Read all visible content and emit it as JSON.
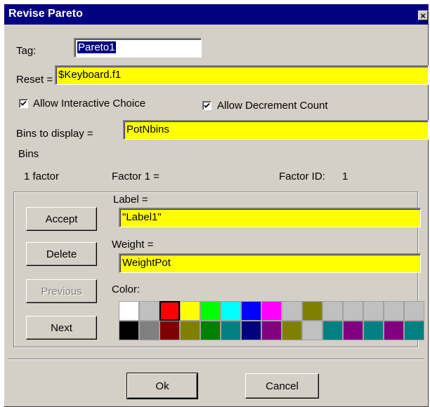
{
  "window": {
    "title": "Revise Pareto",
    "close_glyph": "×"
  },
  "tag": {
    "label": "Tag:",
    "value": "Pareto1"
  },
  "reset": {
    "label": "Reset =",
    "value": "$Keyboard.f1"
  },
  "checkboxes": {
    "allow_interactive": {
      "label": "Allow Interactive Choice",
      "checked": true
    },
    "allow_decrement": {
      "label": "Allow Decrement Count",
      "checked": true
    }
  },
  "bins_to_display": {
    "label": "Bins to display =",
    "value": "PotNbins"
  },
  "bins": {
    "group_label": "Bins",
    "factor_count": "1 factor",
    "factor_label": "Factor 1 =",
    "factor_id_label": "Factor ID:",
    "factor_id_value": "1",
    "label_label": "Label =",
    "label_value": "\"Label1\"",
    "weight_label": "Weight =",
    "weight_value": "WeightPot",
    "color_label": "Color:",
    "buttons": {
      "accept": "Accept",
      "delete": "Delete",
      "previous": "Previous",
      "next": "Next"
    },
    "palette_row1": [
      "#ffffff",
      "#c0c0c0",
      "#ff0000",
      "#ffff00",
      "#00ff00",
      "#00ffff",
      "#0000ff",
      "#ff00ff",
      "#c0c0c0",
      "#808000",
      "#c0c0c0",
      "#c0c0c0",
      "#c0c0c0",
      "#c0c0c0",
      "#c0c0c0"
    ],
    "palette_row2": [
      "#000000",
      "#808080",
      "#800000",
      "#808000",
      "#008000",
      "#008080",
      "#000080",
      "#800080",
      "#808000",
      "#c0c0c0",
      "#008080",
      "#800080",
      "#008080",
      "#800080",
      "#008080"
    ],
    "selected_color": "#ff0000"
  },
  "footer": {
    "ok": "Ok",
    "cancel": "Cancel"
  },
  "colors": {
    "field_yellow": "#ffff00",
    "titlebar": "#000080",
    "face": "#d4d0c8"
  }
}
